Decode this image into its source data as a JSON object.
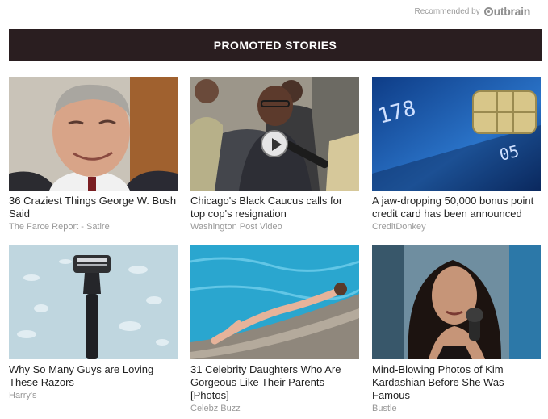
{
  "attribution": {
    "text": "Recommended by",
    "brand": "Outbrain"
  },
  "banner": {
    "title": "PROMOTED STORIES"
  },
  "stories": [
    {
      "title": "36 Craziest Things George W. Bush Said",
      "source": "The Farce Report - Satire",
      "image": "portrait-man-smiling"
    },
    {
      "title": "Chicago's Black Caucus calls for top cop's resignation",
      "source": "Washington Post Video",
      "image": "press-conference-video",
      "video": true
    },
    {
      "title": "A jaw-dropping 50,000 bonus point credit card has been announced",
      "source": "CreditDonkey",
      "image": "blue-credit-card-chip"
    },
    {
      "title": "Why So Many Guys are Loving These Razors",
      "source": "Harry's",
      "image": "razor-water-drops"
    },
    {
      "title": "31 Celebrity Daughters Who Are Gorgeous Like Their Parents [Photos]",
      "source": "Celebz Buzz",
      "image": "woman-poolside"
    },
    {
      "title": "Mind-Blowing Photos of Kim Kardashian Before She Was Famous",
      "source": "Bustle",
      "image": "woman-microphone"
    }
  ],
  "colors": {
    "banner_bg": "#2a1e20",
    "banner_text": "#ffffff",
    "headline": "#222222",
    "source": "#999999"
  }
}
